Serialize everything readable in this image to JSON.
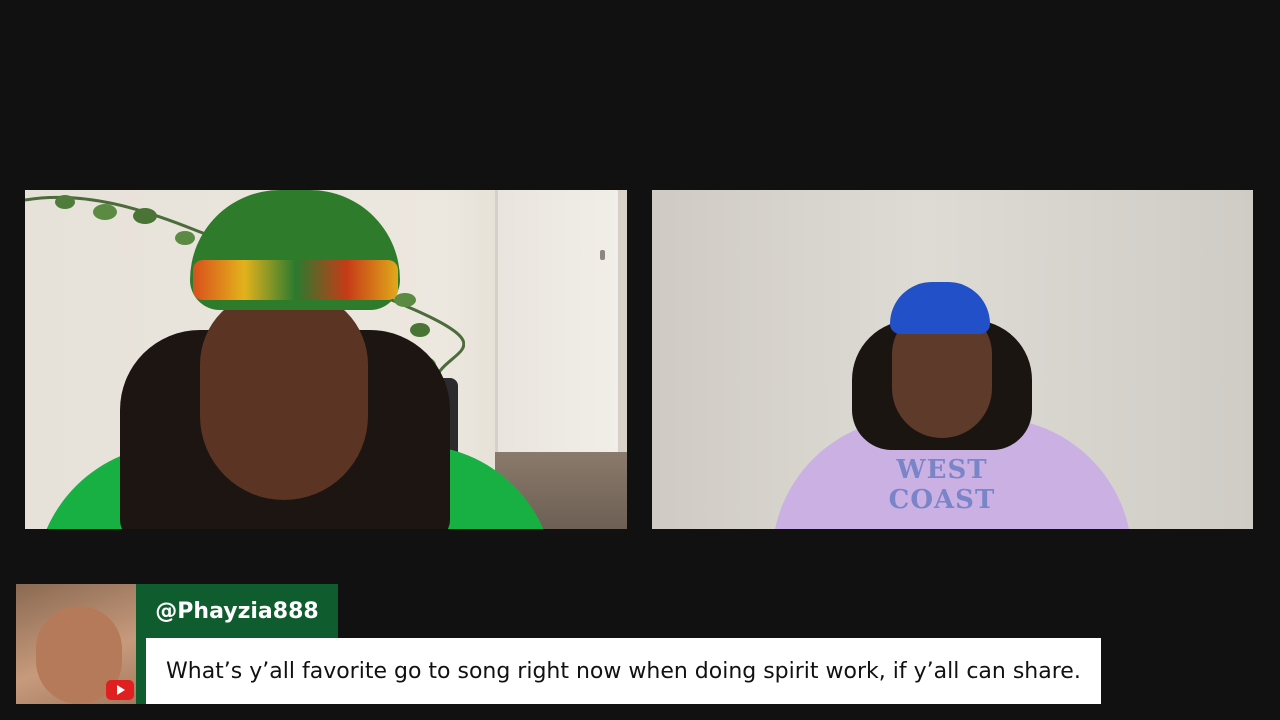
{
  "stream": {
    "participants": [
      {
        "id": "left",
        "icon": "webcam-video-left"
      },
      {
        "id": "right",
        "icon": "webcam-video-right",
        "shirt_text": "WEST COAST"
      }
    ]
  },
  "comment": {
    "username": "@Phayzia888",
    "message": "What’s y’all favorite go to song right now when doing spirit work, if y’all can share.",
    "platform_icon": "youtube-icon",
    "accent_color": "#0f5c2e",
    "platform_color": "#e02020"
  }
}
